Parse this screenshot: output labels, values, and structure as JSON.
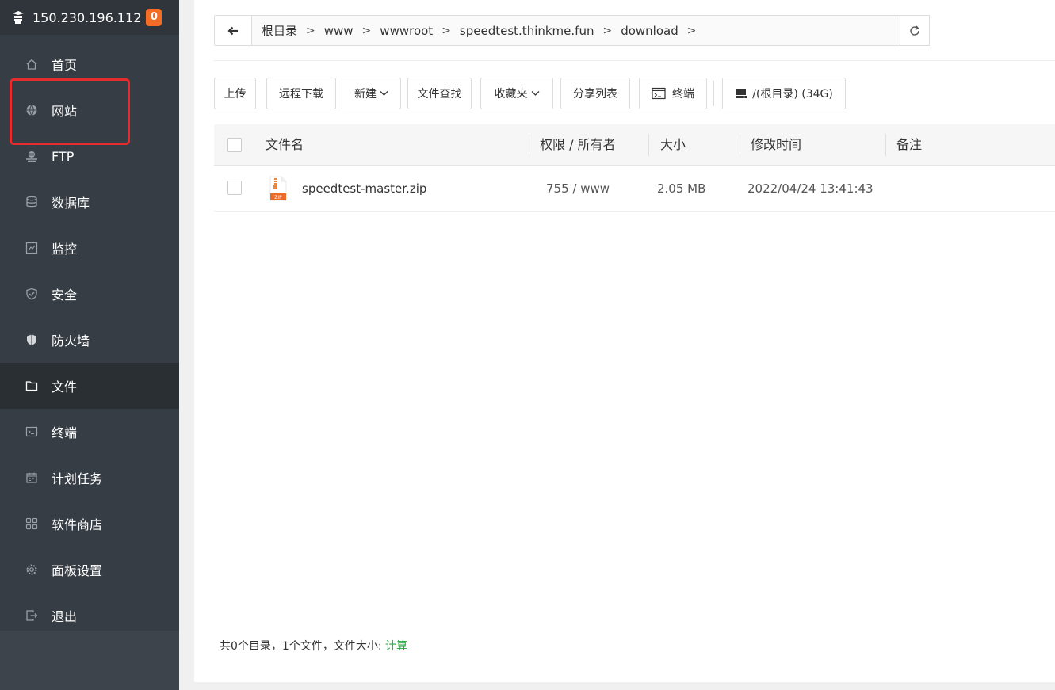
{
  "sidebar": {
    "ip": "150.230.196.112",
    "badge": "0",
    "items": [
      {
        "label": "首页",
        "icon": "home-icon"
      },
      {
        "label": "网站",
        "icon": "globe-icon"
      },
      {
        "label": "FTP",
        "icon": "ftp-icon"
      },
      {
        "label": "数据库",
        "icon": "database-icon"
      },
      {
        "label": "监控",
        "icon": "monitor-icon"
      },
      {
        "label": "安全",
        "icon": "shield-check-icon"
      },
      {
        "label": "防火墙",
        "icon": "firewall-shield-icon"
      },
      {
        "label": "文件",
        "icon": "folder-icon"
      },
      {
        "label": "终端",
        "icon": "terminal-icon"
      },
      {
        "label": "计划任务",
        "icon": "calendar-icon"
      },
      {
        "label": "软件商店",
        "icon": "apps-grid-icon"
      },
      {
        "label": "面板设置",
        "icon": "gear-icon"
      },
      {
        "label": "退出",
        "icon": "logout-icon"
      }
    ],
    "active_item": "文件",
    "highlight_color": "#e62c2c"
  },
  "path": {
    "crumbs": [
      "根目录",
      "www",
      "wwwroot",
      "speedtest.thinkme.fun",
      "download"
    ],
    "separator": ">"
  },
  "toolbar": {
    "upload": "上传",
    "remote_download": "远程下载",
    "new": "新建",
    "file_search": "文件查找",
    "favorites": "收藏夹",
    "share_list": "分享列表",
    "terminal": "终端",
    "disk": "/(根目录) (34G)"
  },
  "table": {
    "headers": {
      "name": "文件名",
      "perm": "权限 / 所有者",
      "size": "大小",
      "mtime": "修改时间",
      "note": "备注"
    },
    "rows": [
      {
        "name": "speedtest-master.zip",
        "perm": "755 / www",
        "size": "2.05 MB",
        "mtime": "2022/04/24 13:41:43",
        "note": "",
        "icon": "zip-file-icon"
      }
    ]
  },
  "status": {
    "summary": "共0个目录，1个文件，文件大小: ",
    "calc_link": "计算"
  },
  "colors": {
    "sidebar_bg": "#363d44",
    "badge": "#f56c24",
    "link_green": "#20a53a"
  }
}
